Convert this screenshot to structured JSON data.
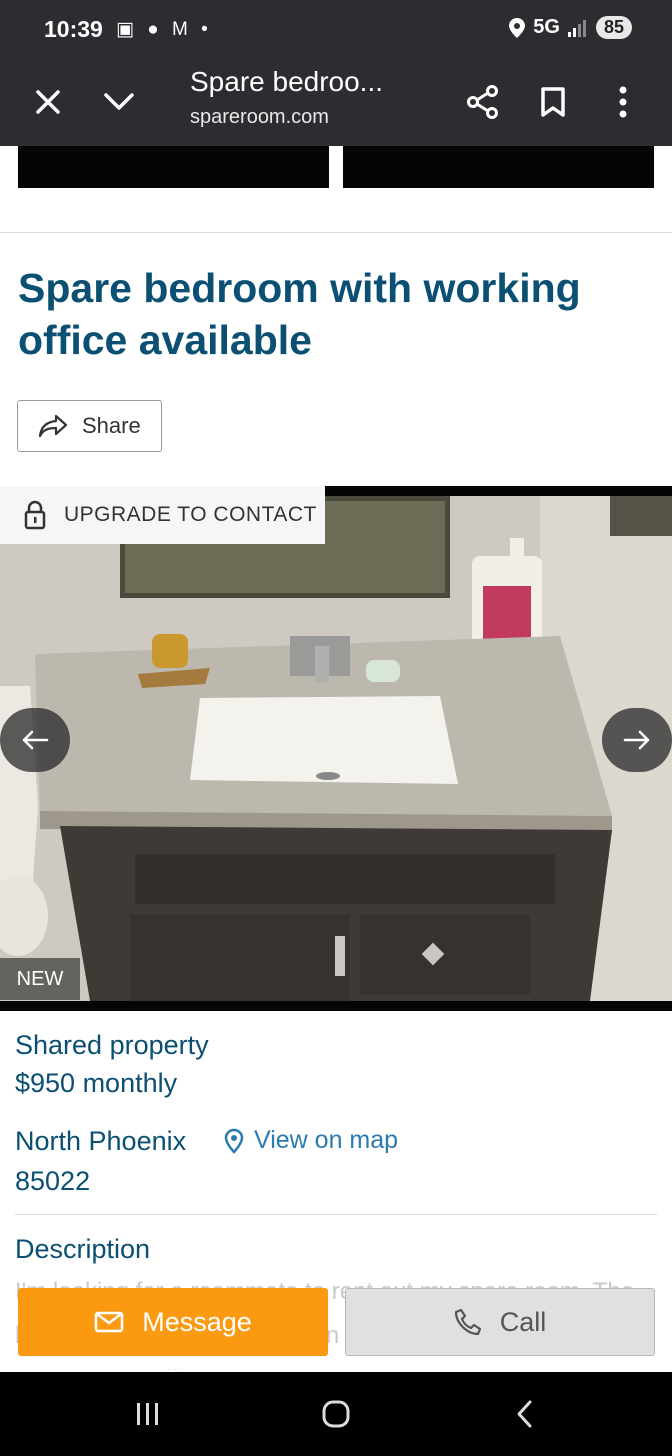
{
  "status_bar": {
    "time": "10:39",
    "notification_icons": "▣ ● M •",
    "network": "5G",
    "battery": "85"
  },
  "browser": {
    "page_title": "Spare bedroo...",
    "url": "spareroom.com"
  },
  "listing": {
    "title": "Spare bedroom with working office available",
    "share_label": "Share",
    "upgrade_label": "UPGRADE TO CONTACT",
    "badge": "NEW",
    "property_type": "Shared property",
    "price": "$950 monthly",
    "area": "North Phoenix",
    "postcode": "85022",
    "view_map_label": "View on map",
    "description_heading": "Description",
    "description_text": "I'm looking for a roommate to rent out my spare room. The bedroom and bathroom are on one side of the hallway & the spare room, office &"
  },
  "actions": {
    "message_label": "Message",
    "call_label": "Call"
  },
  "colors": {
    "heading": "#0b4f72",
    "link": "#2b7bb0",
    "message_button": "#fb9a10"
  }
}
